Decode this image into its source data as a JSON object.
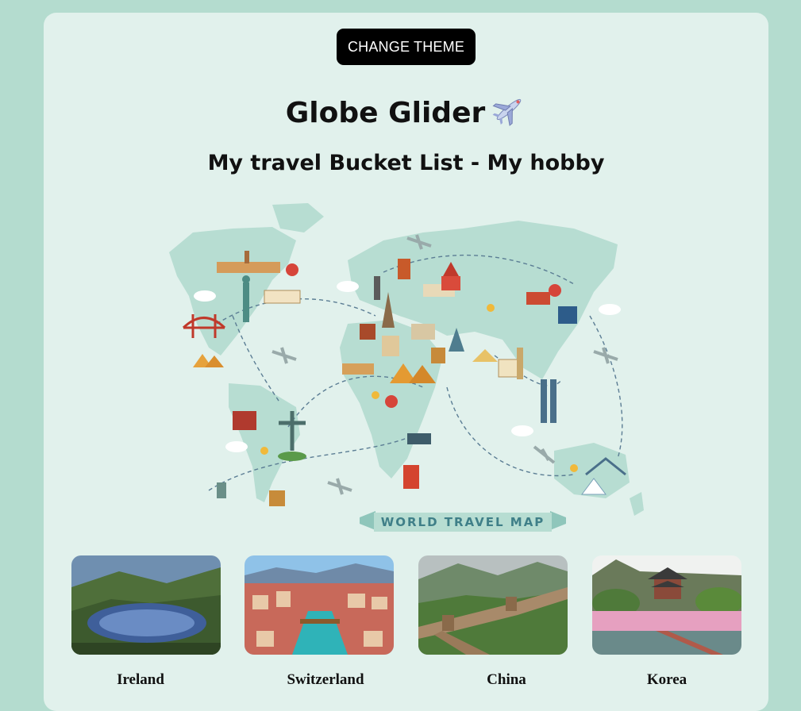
{
  "header": {
    "theme_button_label": "CHANGE THEME",
    "title": "Globe Glider",
    "subtitle": "My travel Bucket List - My hobby"
  },
  "map": {
    "banner_text": "WORLD TRAVEL MAP",
    "ocean_color": "#e1f1ec",
    "land_color": "#b7ddd2"
  },
  "destinations": [
    {
      "name": "Ireland",
      "icon": "lake-landscape-photo"
    },
    {
      "name": "Switzerland",
      "icon": "lucerne-city-photo"
    },
    {
      "name": "China",
      "icon": "great-wall-photo"
    },
    {
      "name": "Korea",
      "icon": "pavilion-photo"
    }
  ],
  "colors": {
    "page_background": "#b4dccf",
    "card_background": "#e1f1ec",
    "button_background": "#000000"
  }
}
